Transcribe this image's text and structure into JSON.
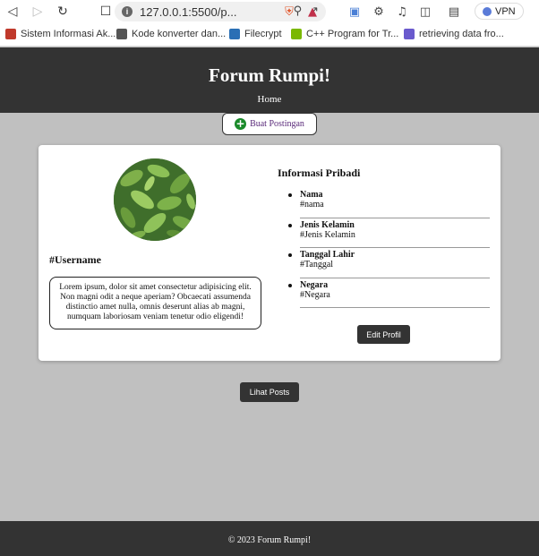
{
  "browser": {
    "url": "127.0.0.1:5500/p...",
    "vpn_label": "VPN"
  },
  "bookmarks": [
    {
      "label": "Sistem Informasi Ak...",
      "color": "#c0392b"
    },
    {
      "label": "Kode konverter dan...",
      "color": "#555555"
    },
    {
      "label": "Filecrypt",
      "color": "#2a6fb5"
    },
    {
      "label": "C++ Program for Tr...",
      "color": "#7ab800"
    },
    {
      "label": "retrieving data fro...",
      "color": "#6a5acd"
    }
  ],
  "header": {
    "title": "Forum Rumpi!",
    "nav_home": "Home"
  },
  "create_post": {
    "label": "Buat Postingan"
  },
  "profile": {
    "username": "#Username",
    "bio": "Lorem ipsum, dolor sit amet consectetur adipisicing elit. Non magni odit a neque aperiam? Obcaecati assumenda distinctio amet nulla, omnis deserunt alias ab magni, numquam laboriosam veniam tenetur odio eligendi!"
  },
  "personal_info": {
    "title": "Informasi Pribadi",
    "items": [
      {
        "label": "Nama",
        "value": "#nama"
      },
      {
        "label": "Jenis Kelamin",
        "value": "#Jenis Kelamin"
      },
      {
        "label": "Tanggal Lahir",
        "value": "#Tanggal"
      },
      {
        "label": "Negara",
        "value": "#Negara"
      }
    ],
    "edit_label": "Edit Profil"
  },
  "view_posts_label": "Lihat Posts",
  "footer": {
    "text": "© 2023 Forum Rumpi!"
  }
}
